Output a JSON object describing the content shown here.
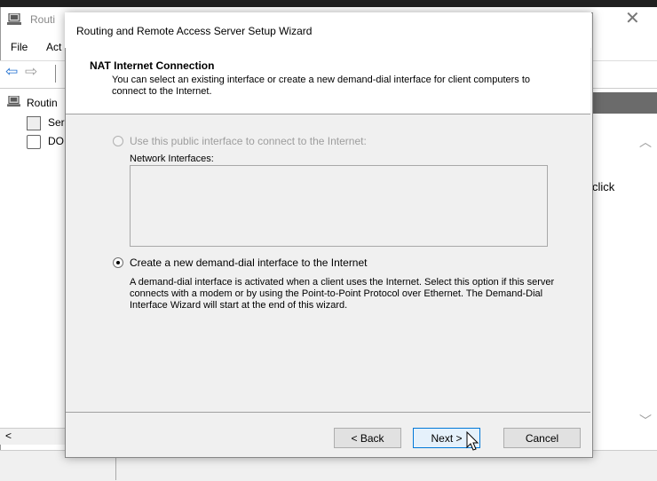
{
  "background": {
    "window_title": "Routi",
    "menu": {
      "file": "File",
      "action": "Act"
    },
    "tree": {
      "root": "Routin",
      "server": "Ser",
      "do": "DO"
    },
    "right_text": "click"
  },
  "wizard": {
    "title": "Routing and Remote Access Server Setup Wizard",
    "heading": "NAT Internet Connection",
    "subheading": "You can select an existing interface or create a new demand-dial interface for client computers to connect to the Internet.",
    "option1": {
      "label": "Use this public interface to connect to the Internet:",
      "selected": false,
      "enabled": false
    },
    "network_interfaces_label": "Network Interfaces:",
    "option2": {
      "label": "Create a new demand-dial interface to the Internet",
      "selected": true,
      "enabled": true
    },
    "option2_description": "A demand-dial interface is activated when a client uses the Internet. Select this option if this server connects with a modem or by using the Point-to-Point Protocol over Ethernet. The Demand-Dial Interface Wizard will start at the end of this wizard.",
    "buttons": {
      "back": "< Back",
      "next": "Next >",
      "cancel": "Cancel"
    }
  },
  "colors": {
    "accent": "#0078d7",
    "disabled_text": "#9d9d9d"
  }
}
